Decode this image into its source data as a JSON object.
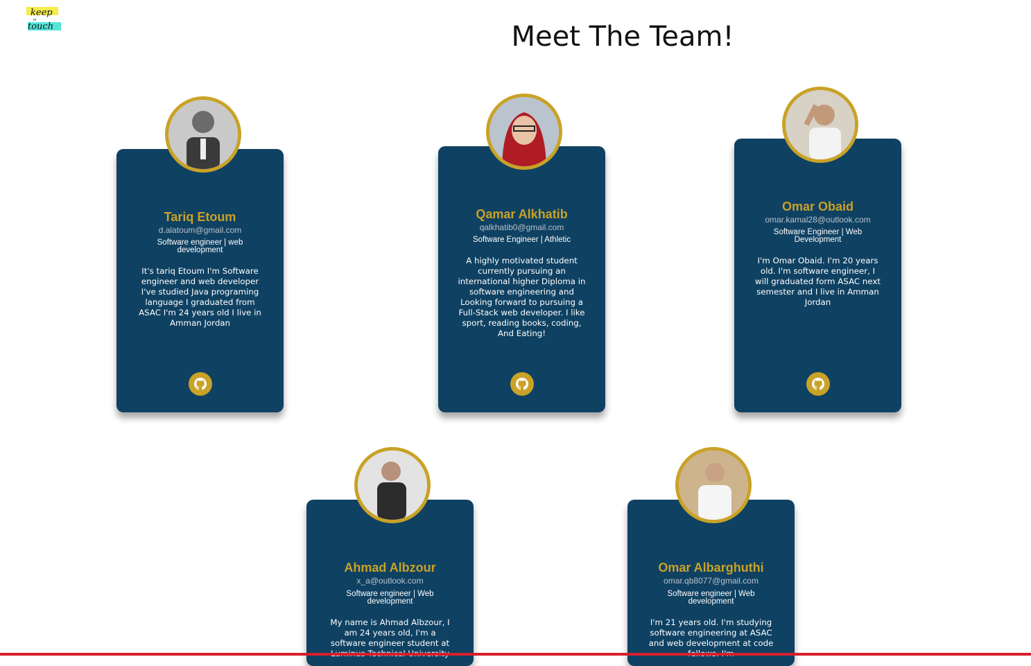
{
  "header": {
    "logo_alt": "keep in touch",
    "title": "Meet The Team!"
  },
  "team": [
    {
      "name": "Tariq Etoum",
      "email": "d.alatoum@gmail.com",
      "role": "Software engineer | web development",
      "bio": "It's tariq Etoum I'm Software engineer and web developer I've studied Java programing language I graduated from ASAC I'm 24 years old I live in Amman Jordan",
      "icon": "github-icon"
    },
    {
      "name": "Qamar Alkhatib",
      "email": "qalkhatib0@gmail.com",
      "role": "Software Engineer | Athletic",
      "bio": "A highly motivated student currently pursuing an international higher Diploma in software engineering and Looking forward to pursuing a Full-Stack web developer. I like sport, reading books, coding, And Eating!",
      "icon": "github-icon"
    },
    {
      "name": "Omar Obaid",
      "email": "omar.kamal28@outlook.com",
      "role": "Software Engineer | Web Development",
      "bio": "I'm Omar Obaid. I'm 20 years old. I'm software engineer, I will graduated form ASAC next semester and I live in Amman Jordan",
      "icon": "github-icon"
    },
    {
      "name": "Ahmad Albzour",
      "email": "x_a@outlook.com",
      "role": "Software engineer | Web development",
      "bio": "My name is Ahmad Albzour, I am 24 years old, I'm a software engineer student at Luminus Technical University",
      "icon": "github-icon"
    },
    {
      "name": "Omar Albarghuthi",
      "email": "omar.qb8077@gmail.com",
      "role": "Software engineer | Web development",
      "bio": "I'm 21 years old. I'm studying software engineering at ASAC and web development at code fellows. I'm",
      "icon": "github-icon"
    }
  ],
  "colors": {
    "card": "#0f4162",
    "accent": "#c9a227",
    "bottom_bar": "#d61f2c"
  }
}
